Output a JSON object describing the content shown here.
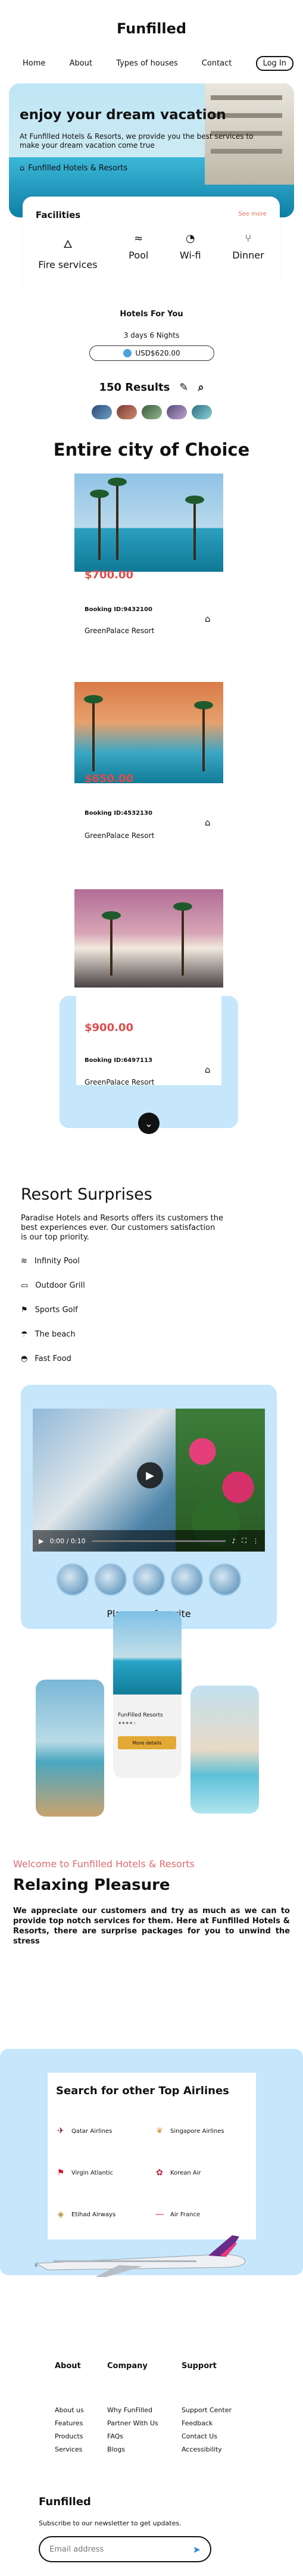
{
  "brand": "Funfilled",
  "nav": {
    "home": "Home",
    "about": "About",
    "types": "Types of houses",
    "contact": "Contact",
    "login": "Log In"
  },
  "hero": {
    "title": "enjoy your dream vacation",
    "desc": "At Funfilled Hotels & Resorts, we provide you the best services to make your dream vacation come true",
    "location": "Funfilled Hotels & Resorts"
  },
  "facilities": {
    "title": "Facilities",
    "see_more": "See more",
    "items": [
      {
        "label": "Fire services",
        "icon": "fire-icon"
      },
      {
        "label": "Pool",
        "icon": "pool-icon"
      },
      {
        "label": "Wi-fi",
        "icon": "wifi-icon"
      },
      {
        "label": "Dinner",
        "icon": "dinner-icon"
      }
    ]
  },
  "search": {
    "hotels_for": "Hotels For You",
    "nights": "3 days 6 Nights",
    "price": "USD$620.00",
    "results": "150 Results"
  },
  "city": {
    "title": "Entire city of Choice"
  },
  "listings": [
    {
      "price": "$700.00",
      "booking": "Booking ID:9432100",
      "resort": "GreenPalace Resort"
    },
    {
      "price": "$650.00",
      "booking": "Booking ID:4532130",
      "resort": "GreenPalace Resort"
    },
    {
      "price": "$900.00",
      "booking": "Booking ID:6497113",
      "resort": "GreenPalace Resort"
    }
  ],
  "surprises": {
    "title": "Resort Surprises",
    "desc": "Paradise Hotels and Resorts offers its customers the best experiences ever. Our customers satisfaction is our top priority.",
    "amenities": [
      {
        "label": "Infinity Pool",
        "icon": "pool-icon"
      },
      {
        "label": "Outdoor Grill",
        "icon": "grill-icon"
      },
      {
        "label": "Sports Golf",
        "icon": "golf-icon"
      },
      {
        "label": "The beach",
        "icon": "beach-icon"
      },
      {
        "label": "Fast Food",
        "icon": "burger-icon"
      }
    ]
  },
  "video": {
    "time": "0:00 / 0:10",
    "caption": "Play your favorite"
  },
  "promo": {
    "name": "FunFilled Resorts",
    "stars": "★★★★☆",
    "button": "More details"
  },
  "relax": {
    "welcome": "Welcome to Funfilled Hotels & Resorts",
    "title": "Relaxing Pleasure",
    "desc": "We appreciate our customers and try as much as we can to provide top notch services for them. Here at Funfilled Hotels & Resorts, there are surprise packages for you to unwind the stress"
  },
  "airlines": {
    "title": "Search for other Top Airlines",
    "items": [
      "Qatar Airlines",
      "Singapore Airlines",
      "Virgin Atlantic",
      "Korean Air",
      "Etihad Airways",
      "Air France"
    ]
  },
  "footer": {
    "about": {
      "title": "About",
      "links": [
        "About us",
        "Features",
        "Products",
        "Services"
      ]
    },
    "company": {
      "title": "Company",
      "links": [
        "Why FunFilled",
        "Partner With Us",
        "FAQs",
        "Blogs"
      ]
    },
    "support": {
      "title": "Support",
      "links": [
        "Support Center",
        "Feedback",
        "Contact Us",
        "Accessibility"
      ]
    },
    "brand": "Funfilled",
    "subscribe": "Subscribe to our newsletter to get updates.",
    "email_placeholder": "Email address"
  },
  "colors": {
    "accent_blue": "#c5e6fb",
    "price_red": "#e14b4b",
    "welcome_red": "#e36b6b",
    "button_gold": "#e4a934"
  }
}
